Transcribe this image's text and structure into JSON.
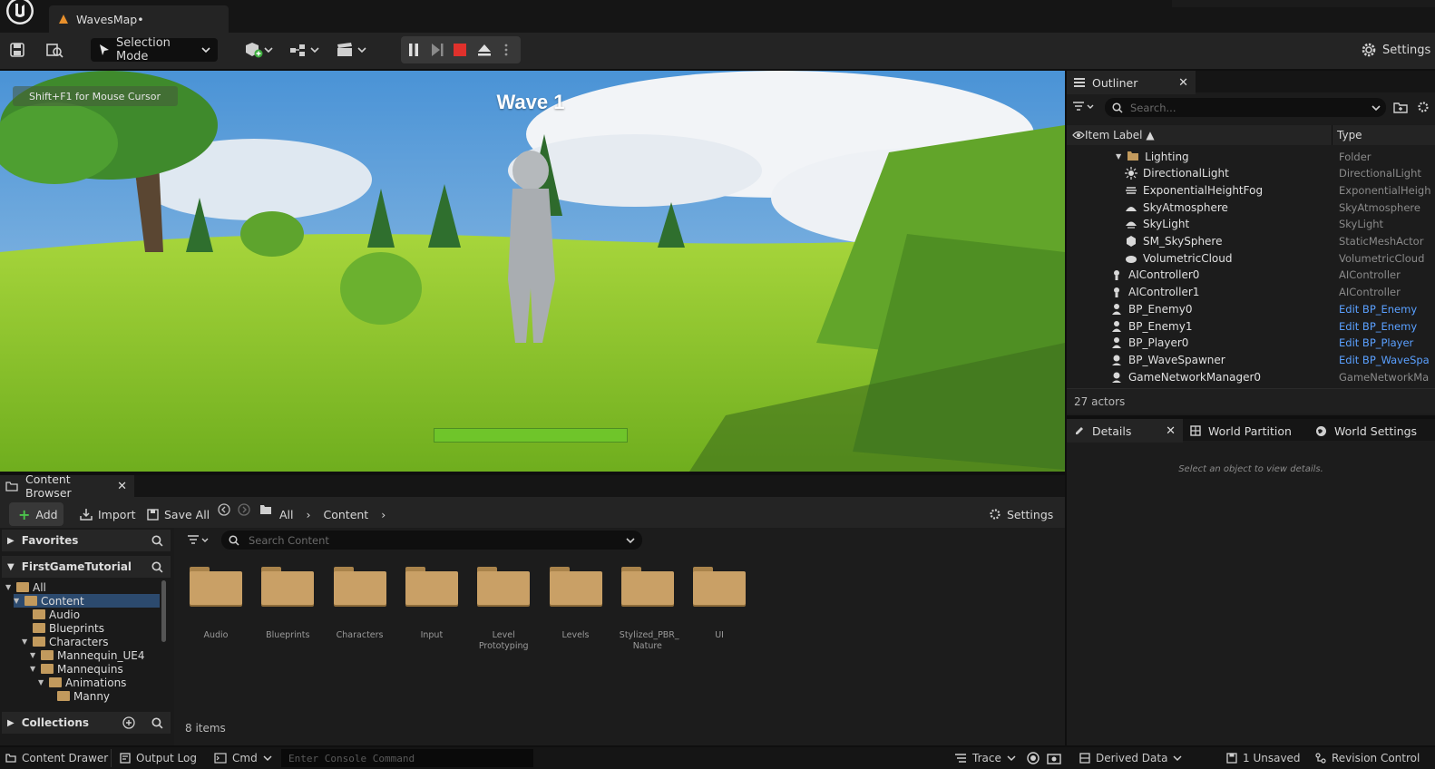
{
  "document_tab": {
    "title": "WavesMap•"
  },
  "toolbar": {
    "selection_mode": "Selection Mode",
    "settings": "Settings"
  },
  "viewport": {
    "hint": "Shift+F1 for Mouse Cursor",
    "wave_text": "Wave 1",
    "health_fraction": 1.0
  },
  "outliner": {
    "tab_label": "Outliner",
    "search_placeholder": "Search...",
    "col_label": "Item Label ▲",
    "col_type": "Type",
    "rows": [
      {
        "label": "Lighting",
        "type": "Folder",
        "icon": "folder-icon",
        "indent": 1,
        "link": false
      },
      {
        "label": "DirectionalLight",
        "type": "DirectionalLight",
        "icon": "sun-icon",
        "indent": 2,
        "link": false
      },
      {
        "label": "ExponentialHeightFog",
        "type": "ExponentialHeigh",
        "icon": "fog-icon",
        "indent": 2,
        "link": false
      },
      {
        "label": "SkyAtmosphere",
        "type": "SkyAtmosphere",
        "icon": "atmosphere-icon",
        "indent": 2,
        "link": false
      },
      {
        "label": "SkyLight",
        "type": "SkyLight",
        "icon": "skylight-icon",
        "indent": 2,
        "link": false
      },
      {
        "label": "SM_SkySphere",
        "type": "StaticMeshActor",
        "icon": "mesh-icon",
        "indent": 2,
        "link": false
      },
      {
        "label": "VolumetricCloud",
        "type": "VolumetricCloud",
        "icon": "cloud-icon",
        "indent": 2,
        "link": false
      },
      {
        "label": "AIController0",
        "type": "AIController",
        "icon": "pawn-icon",
        "indent": 1,
        "link": false
      },
      {
        "label": "AIController1",
        "type": "AIController",
        "icon": "pawn-icon",
        "indent": 1,
        "link": false
      },
      {
        "label": "BP_Enemy0",
        "type": "Edit BP_Enemy",
        "icon": "character-icon",
        "indent": 1,
        "link": true
      },
      {
        "label": "BP_Enemy1",
        "type": "Edit BP_Enemy",
        "icon": "character-icon",
        "indent": 1,
        "link": true
      },
      {
        "label": "BP_Player0",
        "type": "Edit BP_Player",
        "icon": "character-icon",
        "indent": 1,
        "link": true
      },
      {
        "label": "BP_WaveSpawner",
        "type": "Edit BP_WaveSpa",
        "icon": "actor-icon",
        "indent": 1,
        "link": true
      },
      {
        "label": "GameNetworkManager0",
        "type": "GameNetworkMa",
        "icon": "actor-icon",
        "indent": 1,
        "link": false
      }
    ],
    "actor_count": "27 actors"
  },
  "details": {
    "tabs": [
      "Details",
      "World Partition",
      "World Settings"
    ],
    "empty_message": "Select an object to view details."
  },
  "content_browser": {
    "tab_label": "Content Browser",
    "add": "Add",
    "import": "Import",
    "save_all": "Save All",
    "path": [
      "All",
      "Content"
    ],
    "settings": "Settings",
    "favorites": "Favorites",
    "project": "FirstGameTutorial",
    "collections": "Collections",
    "search_placeholder": "Search Content",
    "tree": [
      {
        "label": "All",
        "indent": 0,
        "selected": false,
        "arrow": true
      },
      {
        "label": "Content",
        "indent": 1,
        "selected": true,
        "arrow": true
      },
      {
        "label": "Audio",
        "indent": 2,
        "selected": false,
        "arrow": false
      },
      {
        "label": "Blueprints",
        "indent": 2,
        "selected": false,
        "arrow": false
      },
      {
        "label": "Characters",
        "indent": 2,
        "selected": false,
        "arrow": true
      },
      {
        "label": "Mannequin_UE4",
        "indent": 3,
        "selected": false,
        "arrow": true
      },
      {
        "label": "Mannequins",
        "indent": 3,
        "selected": false,
        "arrow": true
      },
      {
        "label": "Animations",
        "indent": 4,
        "selected": false,
        "arrow": true
      },
      {
        "label": "Manny",
        "indent": 5,
        "selected": false,
        "arrow": false
      }
    ],
    "assets": [
      {
        "name": "Audio"
      },
      {
        "name": "Blueprints"
      },
      {
        "name": "Characters"
      },
      {
        "name": "Input"
      },
      {
        "name": "Level\nPrototyping"
      },
      {
        "name": "Levels"
      },
      {
        "name": "Stylized_PBR_\nNature"
      },
      {
        "name": "UI"
      }
    ],
    "item_count": "8 items"
  },
  "statusbar": {
    "content_drawer": "Content Drawer",
    "output_log": "Output Log",
    "cmd": "Cmd",
    "console_placeholder": "Enter Console Command",
    "trace": "Trace",
    "derived_data": "Derived Data",
    "unsaved": "1 Unsaved",
    "revision_control": "Revision Control"
  },
  "colors": {
    "accent_link": "#5aa0ff",
    "folder": "#c29a5d",
    "stop_red": "#e0312c",
    "health_green": "#6fc52a"
  }
}
